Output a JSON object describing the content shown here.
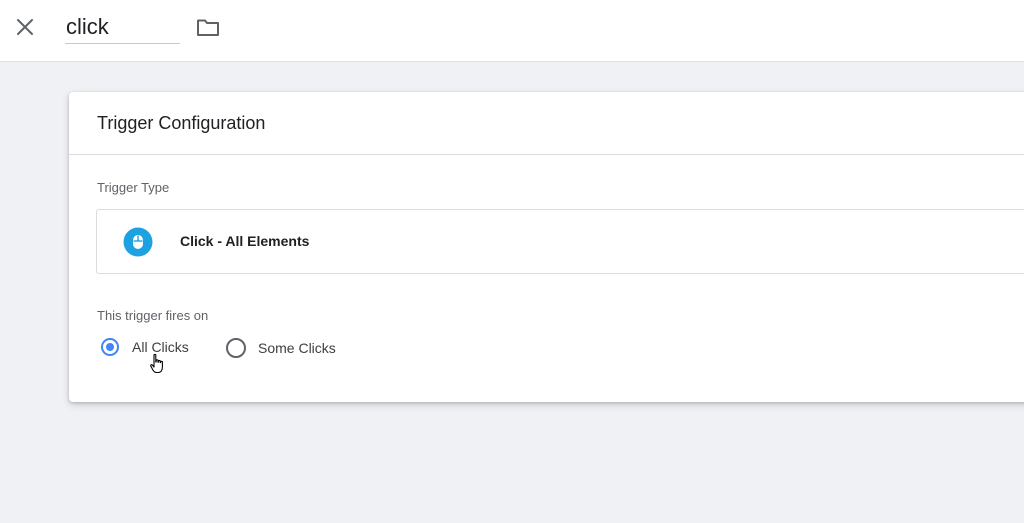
{
  "header": {
    "close_icon": "close-icon",
    "name_value": "click",
    "folder_icon": "folder-icon"
  },
  "card": {
    "title": "Trigger Configuration",
    "trigger_type_label": "Trigger Type",
    "trigger_type": {
      "icon": "mouse-icon",
      "icon_color": "#1ea1e0",
      "label": "Click - All Elements"
    },
    "fires_on_label": "This trigger fires on",
    "options": [
      {
        "label": "All Clicks",
        "selected": true
      },
      {
        "label": "Some Clicks",
        "selected": false
      }
    ]
  },
  "colors": {
    "accent": "#4285f4",
    "background": "#eff1f4"
  }
}
